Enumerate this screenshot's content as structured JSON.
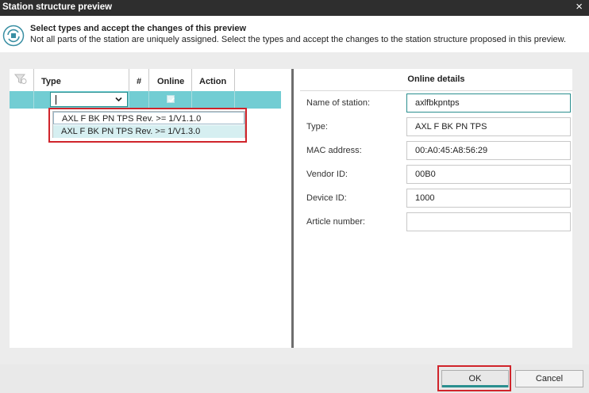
{
  "window": {
    "title": "Station structure preview",
    "close_glyph": "×"
  },
  "header": {
    "icon": "station-sync-icon",
    "line1": "Select types and accept the changes of this preview",
    "line2": "Not all parts of the station are uniquely assigned. Select the types and accept the changes to the station structure proposed in this preview."
  },
  "grid": {
    "columns": {
      "filter": "filter-icon",
      "type": "Type",
      "number": "#",
      "online": "Online",
      "action": "Action"
    },
    "row": {
      "type_value": "",
      "online_checked": true
    },
    "dropdown_options": [
      "AXL F BK PN TPS Rev. >= 1/V1.1.0",
      "AXL F BK PN TPS Rev. >= 1/V1.3.0"
    ]
  },
  "online_details": {
    "title": "Online details",
    "fields": [
      {
        "label": "Name of station:",
        "value": "axlfbkpntps"
      },
      {
        "label": "Type:",
        "value": "AXL F BK PN TPS"
      },
      {
        "label": "MAC address:",
        "value": "00:A0:45:A8:56:29"
      },
      {
        "label": "Vendor ID:",
        "value": "00B0"
      },
      {
        "label": "Device ID:",
        "value": "1000"
      },
      {
        "label": "Article number:",
        "value": ""
      }
    ]
  },
  "footer": {
    "ok_label": "OK",
    "cancel_label": "Cancel"
  },
  "colors": {
    "accent": "#2a8f8f",
    "selected_row": "#72cdd3",
    "highlight_box": "#d0242b"
  }
}
